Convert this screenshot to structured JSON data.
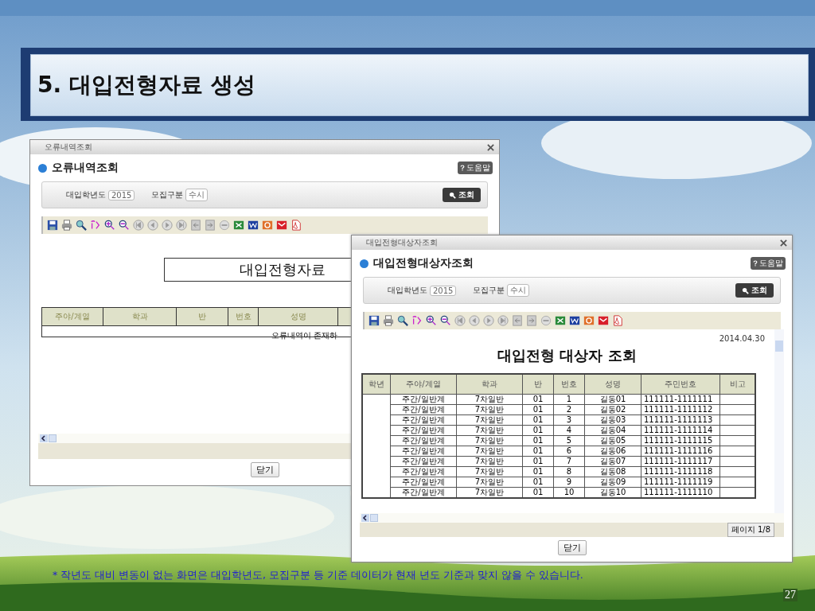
{
  "slide": {
    "title": "5. 대입전형자료 생성",
    "footnote": "* 작년도 대비 변동이 없는 화면은 대입학년도, 모집구분 등 기준 데이터가 현재 년도 기준과 맞지 않을 수 있습니다.",
    "page_number": "27"
  },
  "error_window": {
    "title": "오류내역조회",
    "heading": "오류내역조회",
    "help_button": "도움말",
    "filters": [
      {
        "label": "대입학년도",
        "value": "2015"
      },
      {
        "label": "모집구분",
        "value": "수시"
      }
    ],
    "search_button": "조회",
    "report_title": "대입전형자료",
    "columns": [
      "주야/계열",
      "학과",
      "반",
      "번호",
      "성명"
    ],
    "message": "오류내역이 존재하",
    "close_button": "닫기"
  },
  "target_window": {
    "title": "대입전형대상자조회",
    "heading": "대입전형대상자조회",
    "help_button": "도움말",
    "filters": [
      {
        "label": "대입학년도",
        "value": "2015"
      },
      {
        "label": "모집구분",
        "value": "수시"
      }
    ],
    "search_button": "조회",
    "date": "2014.04.30",
    "report_title": "대입전형 대상자 조회",
    "columns": [
      "학년",
      "주야/계열",
      "학과",
      "반",
      "번호",
      "성명",
      "주민번호",
      "비고"
    ],
    "rows": [
      {
        "track": "주간/일반계",
        "dept": "7차일반",
        "class": "01",
        "no": "1",
        "name": "길동01",
        "id": "111111-1111111"
      },
      {
        "track": "주간/일반계",
        "dept": "7차일반",
        "class": "01",
        "no": "2",
        "name": "길동02",
        "id": "111111-1111112"
      },
      {
        "track": "주간/일반계",
        "dept": "7차일반",
        "class": "01",
        "no": "3",
        "name": "길동03",
        "id": "111111-1111113"
      },
      {
        "track": "주간/일반계",
        "dept": "7차일반",
        "class": "01",
        "no": "4",
        "name": "길동04",
        "id": "111111-1111114"
      },
      {
        "track": "주간/일반계",
        "dept": "7차일반",
        "class": "01",
        "no": "5",
        "name": "길동05",
        "id": "111111-1111115"
      },
      {
        "track": "주간/일반계",
        "dept": "7차일반",
        "class": "01",
        "no": "6",
        "name": "길동06",
        "id": "111111-1111116"
      },
      {
        "track": "주간/일반계",
        "dept": "7차일반",
        "class": "01",
        "no": "7",
        "name": "길동07",
        "id": "111111-1111117"
      },
      {
        "track": "주간/일반계",
        "dept": "7차일반",
        "class": "01",
        "no": "8",
        "name": "길동08",
        "id": "111111-1111118"
      },
      {
        "track": "주간/일반계",
        "dept": "7차일반",
        "class": "01",
        "no": "9",
        "name": "길동09",
        "id": "111111-1111119"
      },
      {
        "track": "주간/일반계",
        "dept": "7차일반",
        "class": "01",
        "no": "10",
        "name": "길동10",
        "id": "111111-1111110"
      }
    ],
    "page_status": "페이지 1/8",
    "close_button": "닫기"
  }
}
